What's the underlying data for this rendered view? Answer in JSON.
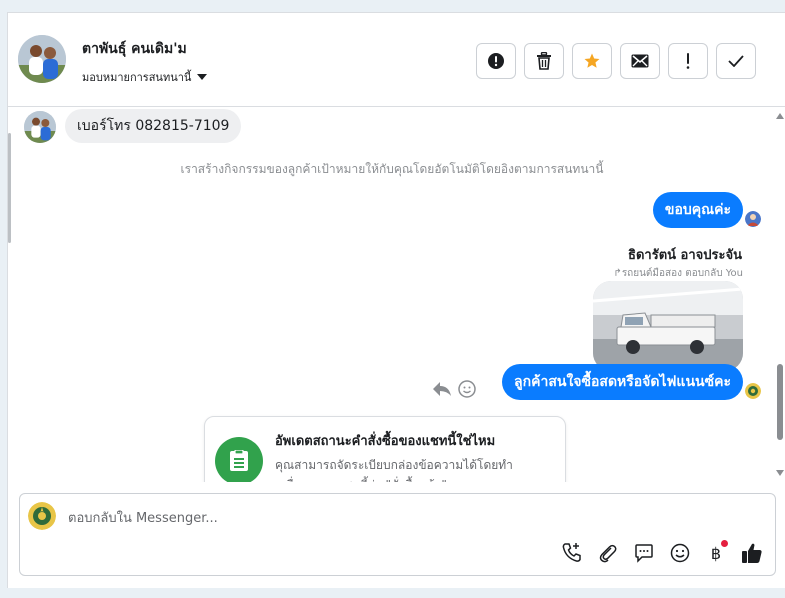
{
  "header": {
    "contact_name": "ตาพันธุ์ คนเดิม'ม",
    "assign_label": "มอบหมายการสนทนานี้"
  },
  "thread": {
    "phone_message": "เบอร์โทร 082815-7109",
    "system_note": "เราสร้างกิจกรรมของลูกค้าเป้าหมายให้กับคุณโดยอัตโนมัติโดยอิงตามการสนทนานี้",
    "outgoing_1": "ขอบคุณค่ะ",
    "reply_sender": "ธิดารัตน์ อาจประจัน",
    "reply_context": "รถยนต์มือสอง ตอบกลับ You",
    "outgoing_2": "ลูกค้าสนใจซื้อสดหรือจัดไฟแนนซ์คะ",
    "card_title": "อัพเดตสถานะคำสั่งซื้อของแชทนี้ใช่ไหม",
    "card_body": "คุณสามารถจัดระเบียบกล่องข้อความได้โดยทำเครื่องหมายแชทนี้ว่า \"สั่งซื้อแล้ว\""
  },
  "composer": {
    "placeholder": "ตอบกลับใน Messenger..."
  },
  "colors": {
    "accent_blue": "#0a7cff",
    "card_green": "#31a24c",
    "star_orange": "#f5a623",
    "notification_red": "#e41e3f"
  }
}
